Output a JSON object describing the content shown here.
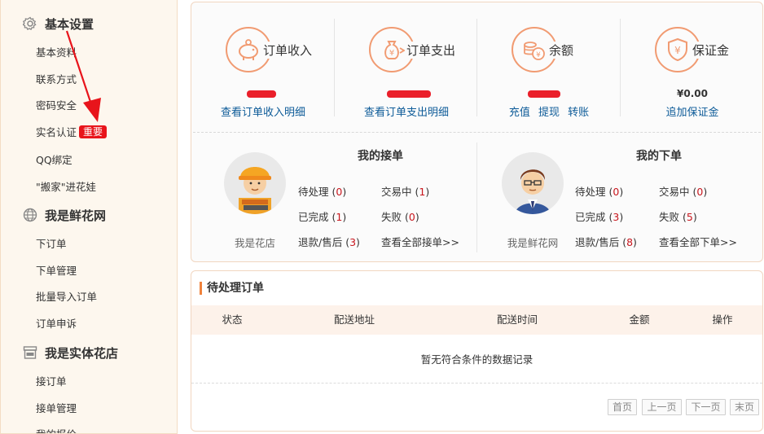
{
  "sidebar": {
    "sections": [
      {
        "icon": "gear-icon",
        "title": "基本设置",
        "items": [
          "基本资料",
          "联系方式",
          "密码安全",
          "实名认证",
          "QQ绑定",
          "\"搬家\"进花娃"
        ]
      },
      {
        "icon": "globe-icon",
        "title": "我是鲜花网",
        "items": [
          "下订单",
          "下单管理",
          "批量导入订单",
          "订单申诉"
        ]
      },
      {
        "icon": "store-icon",
        "title": "我是实体花店",
        "items": [
          "接订单",
          "接单管理",
          "我的报价"
        ]
      }
    ],
    "badge": "重要"
  },
  "stats": [
    {
      "icon": "piggy-bank-icon",
      "title": "订单收入",
      "amount": "",
      "links": [
        "查看订单收入明细"
      ]
    },
    {
      "icon": "money-bag-icon",
      "title": "订单支出",
      "amount": "",
      "links": [
        "查看订单支出明细"
      ]
    },
    {
      "icon": "coins-icon",
      "title": "余额",
      "amount": "",
      "links": [
        "充值",
        "提现",
        "转账"
      ]
    },
    {
      "icon": "shield-yen-icon",
      "title": "保证金",
      "amount": "¥0.00",
      "links": [
        "追加保证金"
      ]
    }
  ],
  "receive": {
    "title": "我的接单",
    "role": "我是花店",
    "pending": {
      "label": "待处理",
      "count": "0"
    },
    "trading": {
      "label": "交易中",
      "count": "1"
    },
    "done": {
      "label": "已完成",
      "count": "1"
    },
    "failed": {
      "label": "失败",
      "count": "0"
    },
    "refund": {
      "label": "退款/售后",
      "count": "3"
    },
    "view_all": "查看全部接单>>"
  },
  "place": {
    "title": "我的下单",
    "role": "我是鲜花网",
    "pending": {
      "label": "待处理",
      "count": "0"
    },
    "trading": {
      "label": "交易中",
      "count": "0"
    },
    "done": {
      "label": "已完成",
      "count": "3"
    },
    "failed": {
      "label": "失败",
      "count": "5"
    },
    "refund": {
      "label": "退款/售后",
      "count": "8"
    },
    "view_all": "查看全部下单>>"
  },
  "pending_orders": {
    "title": "待处理订单",
    "columns": [
      "状态",
      "配送地址",
      "配送时间",
      "金额",
      "操作"
    ],
    "empty_text": "暂无符合条件的数据记录",
    "pager": [
      "首页",
      "上一页",
      "下一页",
      "末页"
    ]
  },
  "colors": {
    "accent": "#f0823c",
    "link": "#0d5b98",
    "count": "#c8161d",
    "badge": "#e8141b"
  }
}
